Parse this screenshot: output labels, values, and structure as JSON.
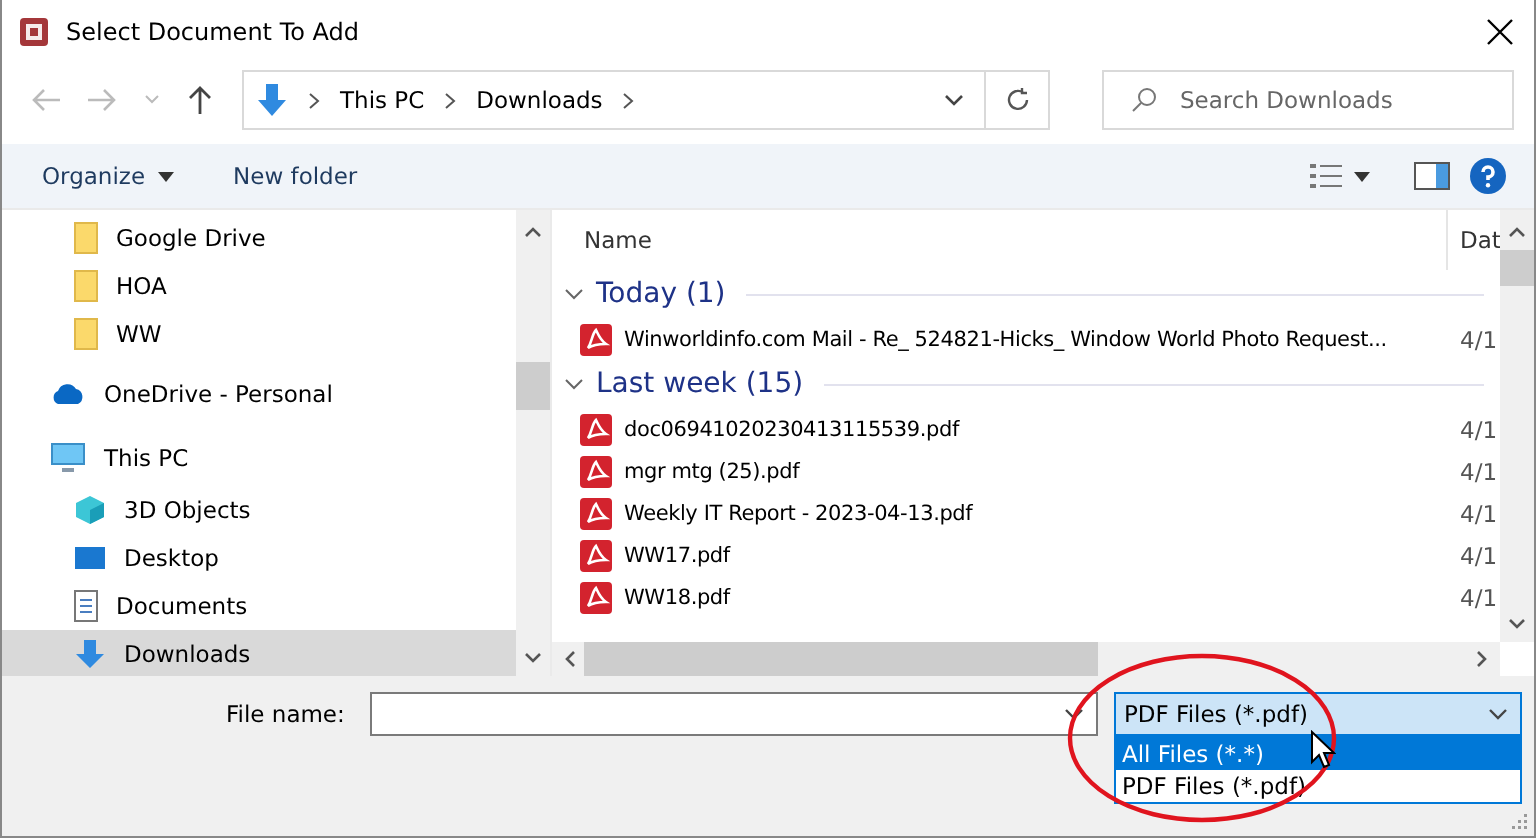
{
  "window": {
    "title": "Select Document To Add"
  },
  "address_bar": {
    "crumbs": [
      "This PC",
      "Downloads"
    ]
  },
  "search": {
    "placeholder": "Search Downloads"
  },
  "toolbar": {
    "organize": "Organize",
    "new_folder": "New folder"
  },
  "sidebar": {
    "continued_items": [
      {
        "label": "Google Drive",
        "kind": "folder",
        "selected": false
      },
      {
        "label": "HOA",
        "kind": "folder",
        "selected": false
      },
      {
        "label": "WW",
        "kind": "folder",
        "selected": false
      }
    ],
    "items": [
      {
        "label": "OneDrive - Personal",
        "kind": "cloud",
        "selected": false
      },
      {
        "label": "This PC",
        "kind": "pc",
        "selected": false,
        "children": [
          {
            "label": "3D Objects",
            "kind": "cube",
            "selected": false
          },
          {
            "label": "Desktop",
            "kind": "desktop",
            "selected": false
          },
          {
            "label": "Documents",
            "kind": "document",
            "selected": false
          },
          {
            "label": "Downloads",
            "kind": "download",
            "selected": true
          }
        ]
      }
    ]
  },
  "file_list": {
    "columns": [
      "Name",
      "Dat"
    ],
    "groups": [
      {
        "title": "Today (1)",
        "expanded": true,
        "files": [
          {
            "name": "Winworldinfo.com Mail - Re_ 524821-Hicks_ Window World Photo Request...",
            "date": "4/1"
          }
        ]
      },
      {
        "title": "Last week (15)",
        "expanded": true,
        "files": [
          {
            "name": "doc06941020230413115539.pdf",
            "date": "4/1"
          },
          {
            "name": "mgr mtg (25).pdf",
            "date": "4/1"
          },
          {
            "name": "Weekly IT Report - 2023-04-13.pdf",
            "date": "4/1"
          },
          {
            "name": "WW17.pdf",
            "date": "4/1"
          },
          {
            "name": "WW18.pdf",
            "date": "4/1"
          }
        ]
      }
    ]
  },
  "file_name": {
    "label": "File name:"
  },
  "file_type": {
    "value": "PDF Files (*.pdf)",
    "expanded": true,
    "options": [
      {
        "label": "All Files (*.*)",
        "highlighted": true
      },
      {
        "label": "PDF Files (*.pdf)",
        "highlighted": false
      }
    ]
  }
}
